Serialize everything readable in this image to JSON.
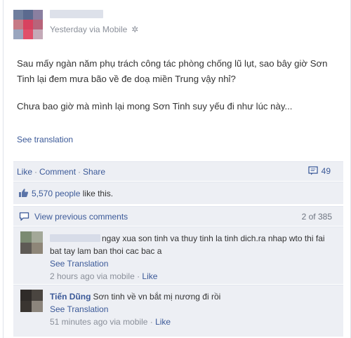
{
  "post": {
    "meta": "Yesterday via Mobile",
    "body_paragraphs": [
      "Sau mấy ngàn năm phụ trách công tác phòng chống lũ lụt, sao bây giờ Sơn Tinh lại đem mưa bão về đe doạ miền Trung vậy nhỉ?",
      "Chưa bao giờ mà mình lại mong Sơn Tinh suy yếu đi như lúc này..."
    ],
    "see_translation": "See translation"
  },
  "actions": {
    "like": "Like",
    "comment": "Comment",
    "share": "Share",
    "comment_count": "49"
  },
  "likes": {
    "count": "5,570 people",
    "suffix": " like this."
  },
  "previous": {
    "label": "View previous comments",
    "pager": "2 of 385"
  },
  "comments": [
    {
      "author": "",
      "text": "ngay xua son tinh va thuy tinh la tinh dich.ra nhap wto thi fai bat tay lam ban thoi cac bac a",
      "translate": "See Translation",
      "time": "2 hours ago via mobile",
      "like": "Like"
    },
    {
      "author": "Tiến Dũng",
      "text": "Sơn tinh về vn bắt mị nương đi rồi",
      "translate": "See Translation",
      "time": "51 minutes ago via mobile",
      "like": "Like"
    }
  ],
  "colors": {
    "link": "#3b5998",
    "panel": "#edeff4",
    "meta_gray": "#8a8f99"
  },
  "icons": [
    "gear-icon",
    "comment-bubble-icon",
    "thumbs-up-icon",
    "speech-bubble-icon"
  ]
}
